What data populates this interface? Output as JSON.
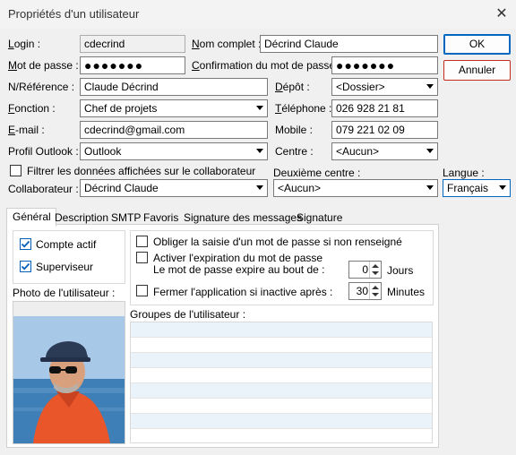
{
  "window": {
    "title": "Propriétés d'un utilisateur"
  },
  "buttons": {
    "ok": "OK",
    "cancel": "Annuler"
  },
  "fields": {
    "login": {
      "label": "Login :",
      "value": "cdecrind"
    },
    "full_name": {
      "label": "Nom complet :",
      "value": "Décrind Claude"
    },
    "password": {
      "label": "Mot de passe :",
      "value": "●●●●●●●"
    },
    "password_confirm": {
      "label": "Confirmation du mot de passe :",
      "value": "●●●●●●●"
    },
    "reference": {
      "label": "N/Référence :",
      "value": "Claude Décrind"
    },
    "depot": {
      "label": "Dépôt :",
      "value": "<Dossier>"
    },
    "function": {
      "label": "Fonction :",
      "value": "Chef de projets"
    },
    "phone": {
      "label": "Téléphone :",
      "value": "026 928 21 81"
    },
    "email": {
      "label": "E-mail :",
      "value": "cdecrind@gmail.com"
    },
    "mobile": {
      "label": "Mobile :",
      "value": "079 221 02 09"
    },
    "outlook_profile": {
      "label": "Profil Outlook :",
      "value": "Outlook"
    },
    "centre": {
      "label": "Centre :",
      "value": "<Aucun>"
    },
    "filter_label": "Filtrer les données affichées sur le collaborateur",
    "second_centre": {
      "label": "Deuxième centre :",
      "value": "<Aucun>"
    },
    "language": {
      "label": "Langue :",
      "value": "Français"
    },
    "collaborator": {
      "label": "Collaborateur :",
      "value": "Décrind Claude"
    }
  },
  "tabs": [
    "Général",
    "Description",
    "SMTP",
    "Favoris",
    "Signature des messages",
    "Signature"
  ],
  "general": {
    "active_account": "Compte actif",
    "supervisor": "Superviseur",
    "force_password": "Obliger la saisie d'un mot de passe si non renseigné",
    "enable_expiry_line1": "Activer l'expiration du mot de passe",
    "enable_expiry_line2": "Le mot de passe expire au bout de :",
    "expiry_value": "0",
    "expiry_unit": "Jours",
    "close_app": "Fermer l'application si inactive après :",
    "close_value": "30",
    "close_unit": "Minutes",
    "photo_label": "Photo de l'utilisateur :",
    "groups_label": "Groupes de l'utilisateur :"
  },
  "colors": {
    "accent": "#005fb8",
    "cancel_border": "#c42b1c",
    "sky": "#9fc3e6",
    "sea": "#3f7fb8",
    "shirt": "#e8562a"
  }
}
